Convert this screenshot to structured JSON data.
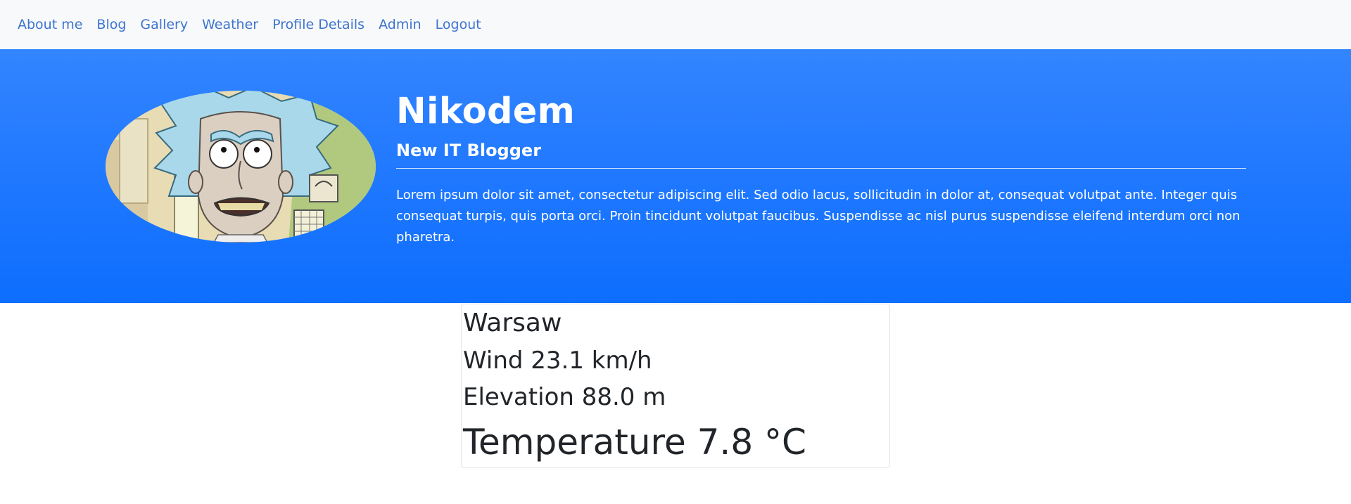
{
  "nav": {
    "items": [
      {
        "label": "About me"
      },
      {
        "label": "Blog"
      },
      {
        "label": "Gallery"
      },
      {
        "label": "Weather"
      },
      {
        "label": "Profile Details"
      },
      {
        "label": "Admin"
      },
      {
        "label": "Logout"
      }
    ],
    "link_color": "#3d74d0"
  },
  "profile": {
    "name": "Nikodem",
    "subtitle": "New IT Blogger",
    "bio": "Lorem ipsum dolor sit amet, consectetur adipiscing elit. Sed odio lacus, sollicitudin in dolor at, consequat volutpat ante. Integer quis consequat turpis, quis porta orci. Proin tincidunt volutpat faucibus. Suspendisse ac nisl purus suspendisse eleifend interdum orci non pharetra.",
    "avatar_icon": "cartoon-portrait-image"
  },
  "weather": {
    "city": "Warsaw",
    "wind": "Wind 23.1 km/h",
    "elevation": "Elevation 88.0 m",
    "temperature": "Temperature 7.8 °C"
  },
  "colors": {
    "hero_blue": "#1e77ff",
    "navbar_bg": "#f8f9fa",
    "text_dark": "#212529"
  }
}
